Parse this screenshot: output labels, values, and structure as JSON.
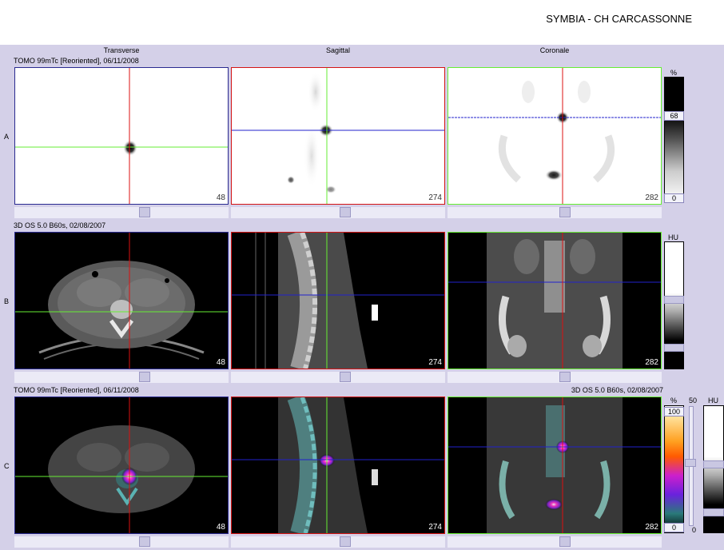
{
  "header": {
    "title": "SYMBIA - CH CARCASSONNE"
  },
  "columns": [
    "Transverse",
    "Sagittal",
    "Coronale"
  ],
  "rows": [
    {
      "letter": "A",
      "info": "TOMO 99mTc [Reoriented], 06/11/2008",
      "info_right": ""
    },
    {
      "letter": "B",
      "info": "3D  OS  5.0  B60s, 02/08/2007",
      "info_right": ""
    },
    {
      "letter": "C",
      "info": "TOMO 99mTc [Reoriented], 06/11/2008",
      "info_right": "3D  OS  5.0  B60s, 02/08/2007"
    }
  ],
  "slice_numbers": [
    "48",
    "274",
    "282"
  ],
  "colorbars": {
    "a": {
      "unit": "%",
      "marker": "68",
      "min": "0"
    },
    "b": {
      "unit": "HU"
    },
    "c": {
      "unit": "%",
      "max": "100",
      "min": "0",
      "window": "50",
      "window_min": "0",
      "ct_unit": "HU"
    }
  },
  "colors": {
    "background": "#d4d0e8",
    "crosshair_red": "#dd1111",
    "crosshair_green": "#66ee33",
    "crosshair_blue": "#2222cc"
  }
}
